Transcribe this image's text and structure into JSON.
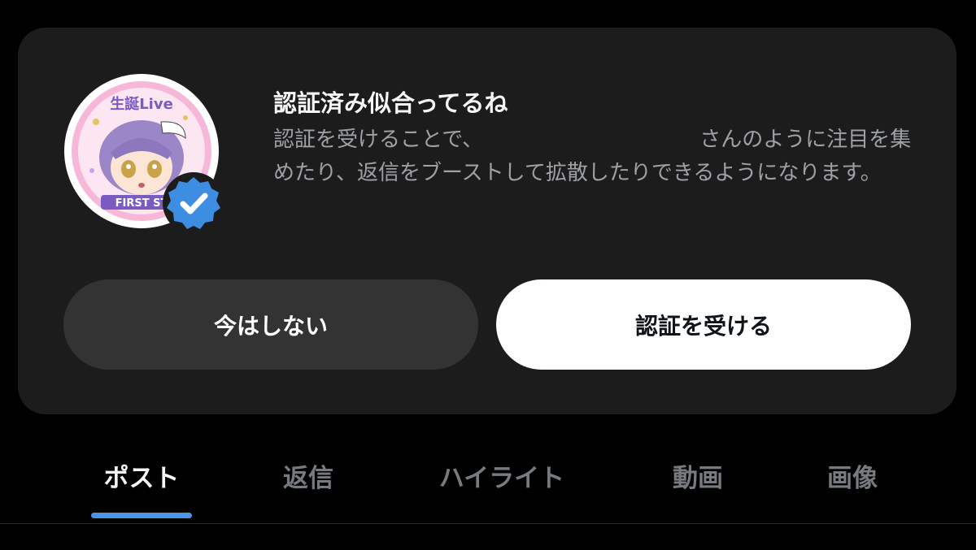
{
  "prompt_card": {
    "title": "認証済み似合ってるね",
    "description_part1": "認証を受けることで、",
    "description_part2": "さんのように注目を集めたり、返信をブーストして拡散したりできるようになります。",
    "avatar_badge_text_top": "生誕Live",
    "avatar_badge_text_bottom": "FIRST ST",
    "dismiss_label": "今はしない",
    "verify_label": "認証を受ける"
  },
  "tabs": [
    {
      "label": "ポスト",
      "active": true
    },
    {
      "label": "返信",
      "active": false
    },
    {
      "label": "ハイライト",
      "active": false
    },
    {
      "label": "動画",
      "active": false
    },
    {
      "label": "画像",
      "active": false
    }
  ],
  "colors": {
    "background": "#000000",
    "card": "#1c1c1d",
    "accent_underline": "#4a95e6",
    "verified_badge": "#3d8ee3"
  }
}
